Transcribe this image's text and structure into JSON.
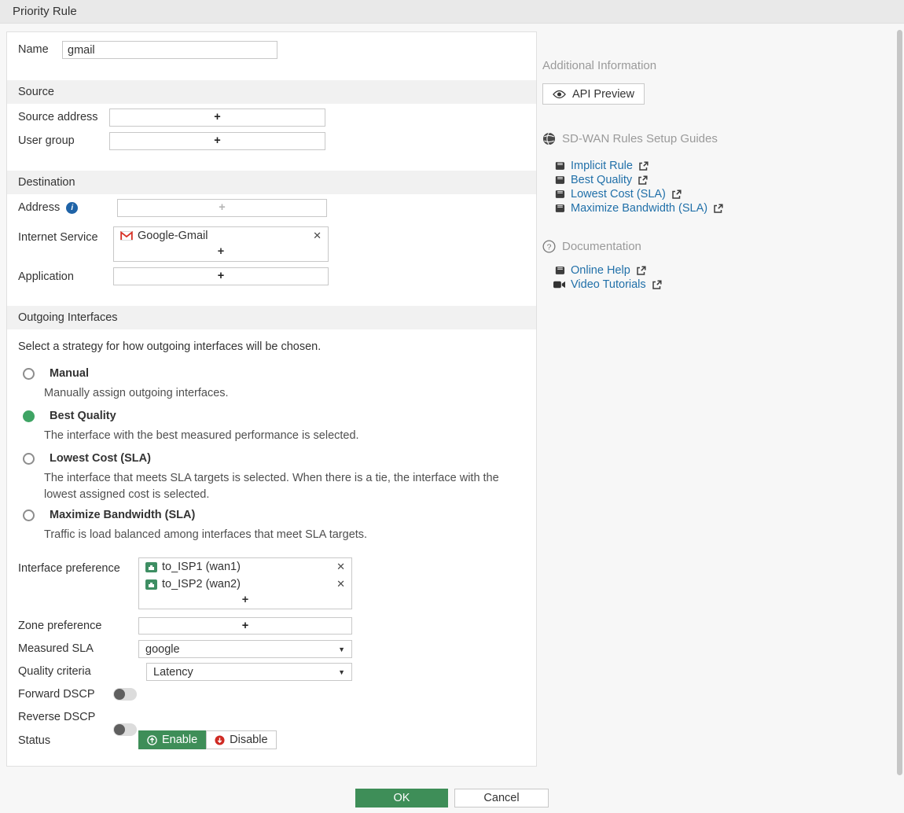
{
  "title": "Priority Rule",
  "glyphs": {
    "add": "+",
    "remove": "✕",
    "caret": "▼"
  },
  "colors": {
    "accent_green": "#3e8e58",
    "radio_green": "#3fa464",
    "link_blue": "#2170a9",
    "disable_red": "#cf2b24",
    "gmail_red": "#d93025",
    "port_green": "#3e8e63"
  },
  "form": {
    "name_label": "Name",
    "name_value": "gmail",
    "source_section": "Source",
    "source_address_label": "Source address",
    "user_group_label": "User group",
    "destination_section": "Destination",
    "address_label": "Address",
    "internet_service_label": "Internet Service",
    "internet_services": [
      {
        "name": "Google-Gmail",
        "icon": "gmail-icon"
      }
    ],
    "application_label": "Application",
    "outgoing_section": "Outgoing Interfaces",
    "strategy_hint": "Select a strategy for how outgoing interfaces will be chosen.",
    "strategies": [
      {
        "label": "Manual",
        "desc": "Manually assign outgoing interfaces.",
        "selected": false
      },
      {
        "label": "Best Quality",
        "desc": "The interface with the best measured performance is selected.",
        "selected": true
      },
      {
        "label": "Lowest Cost (SLA)",
        "desc": "The interface that meets SLA targets is selected. When there is a tie, the interface with the lowest assigned cost is selected.",
        "selected": false
      },
      {
        "label": "Maximize Bandwidth (SLA)",
        "desc": "Traffic is load balanced among interfaces that meet SLA targets.",
        "selected": false
      }
    ],
    "interface_preference_label": "Interface preference",
    "interface_preference": [
      {
        "name": "to_ISP1 (wan1)",
        "icon": "port-icon"
      },
      {
        "name": "to_ISP2 (wan2)",
        "icon": "port-icon"
      }
    ],
    "zone_preference_label": "Zone preference",
    "measured_sla_label": "Measured SLA",
    "measured_sla_value": "google",
    "quality_criteria_label": "Quality criteria",
    "quality_criteria_value": "Latency",
    "forward_dscp_label": "Forward DSCP",
    "forward_dscp_value": "off",
    "reverse_dscp_label": "Reverse DSCP",
    "reverse_dscp_value": "off",
    "status_label": "Status",
    "status_options": [
      "Enable",
      "Disable"
    ],
    "status_value": "Enable"
  },
  "footer": {
    "ok_label": "OK",
    "cancel_label": "Cancel"
  },
  "sidebar": {
    "additional_information_title": "Additional Information",
    "api_preview_label": "API Preview",
    "guides_title": "SD-WAN Rules Setup Guides",
    "guides": [
      {
        "label": "Implicit Rule",
        "icon": "book-icon"
      },
      {
        "label": "Best Quality",
        "icon": "book-icon"
      },
      {
        "label": "Lowest Cost (SLA)",
        "icon": "book-icon"
      },
      {
        "label": "Maximize Bandwidth (SLA)",
        "icon": "book-icon"
      }
    ],
    "documentation_title": "Documentation",
    "docs": [
      {
        "label": "Online Help",
        "icon": "book-icon"
      },
      {
        "label": "Video Tutorials",
        "icon": "video-icon"
      }
    ]
  }
}
